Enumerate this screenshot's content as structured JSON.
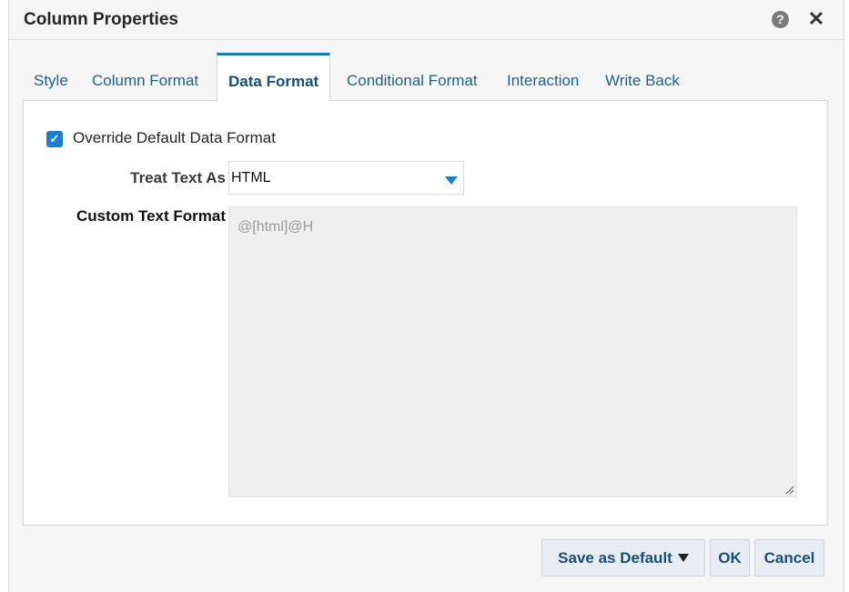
{
  "dialog": {
    "title": "Column Properties",
    "help_icon": "?",
    "close_icon": "✕"
  },
  "tabs": [
    {
      "label": "Style",
      "active": false
    },
    {
      "label": "Column Format",
      "active": false
    },
    {
      "label": "Data Format",
      "active": true
    },
    {
      "label": "Conditional Format",
      "active": false
    },
    {
      "label": "Interaction",
      "active": false
    },
    {
      "label": "Write Back",
      "active": false
    }
  ],
  "override": {
    "checked": true,
    "label": "Override Default Data Format"
  },
  "treat_text_as": {
    "label": "Treat Text As",
    "value": "HTML"
  },
  "custom_text_format": {
    "label": "Custom Text Format",
    "value": "@[html]@H"
  },
  "buttons": {
    "save_as_default": "Save as Default",
    "ok": "OK",
    "cancel": "Cancel"
  },
  "colors": {
    "accent": "#1a7ed4",
    "tab_text": "#1e5f93"
  }
}
